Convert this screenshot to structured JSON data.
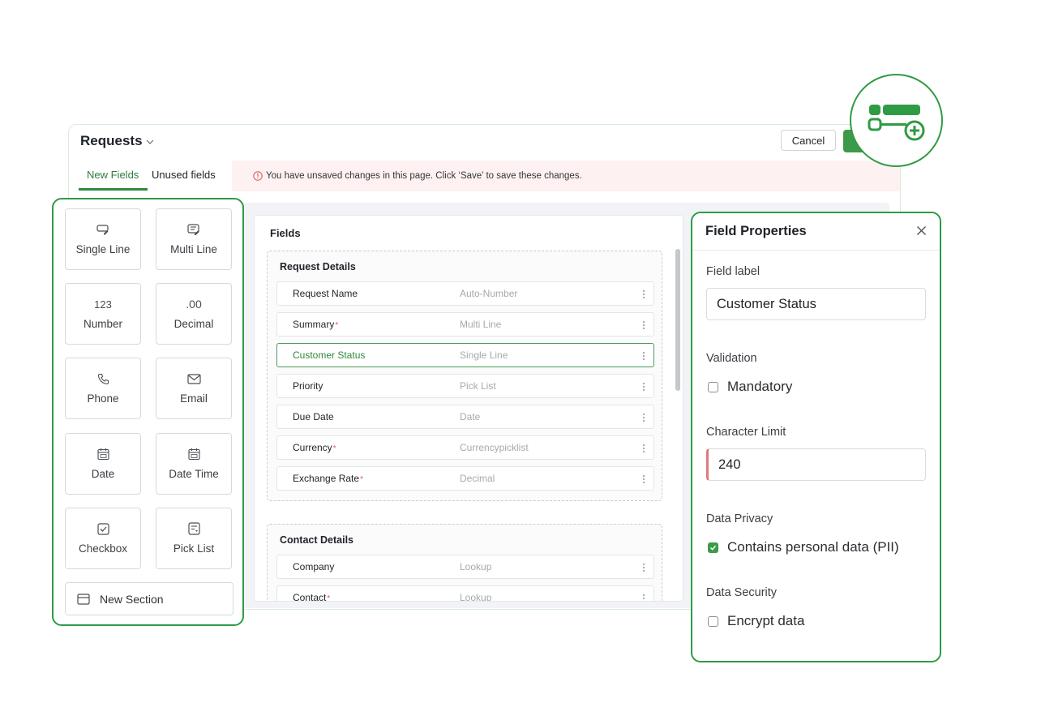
{
  "header": {
    "title": "Requests",
    "cancel_label": "Cancel"
  },
  "tabs": [
    {
      "label": "New Fields",
      "active": true
    },
    {
      "label": "Unused fields",
      "active": false
    }
  ],
  "banner": {
    "text": "You have unsaved changes in this page. Click ‘Save’ to save these changes."
  },
  "palette": {
    "items": [
      {
        "label": "Single Line",
        "icon": "single-line-icon"
      },
      {
        "label": "Multi Line",
        "icon": "multi-line-icon"
      },
      {
        "label": "Number",
        "icon": "number-icon",
        "glyph": "123"
      },
      {
        "label": "Decimal",
        "icon": "decimal-icon",
        "glyph": ".00"
      },
      {
        "label": "Phone",
        "icon": "phone-icon"
      },
      {
        "label": "Email",
        "icon": "email-icon"
      },
      {
        "label": "Date",
        "icon": "calendar-icon"
      },
      {
        "label": "Date Time",
        "icon": "calendar-icon"
      },
      {
        "label": "Checkbox",
        "icon": "checkbox-icon"
      },
      {
        "label": "Pick List",
        "icon": "pick-list-icon"
      }
    ],
    "new_section_label": "New Section"
  },
  "fields_panel": {
    "title": "Fields",
    "sections": [
      {
        "title": "Request Details",
        "rows": [
          {
            "name": "Request Name",
            "type": "Auto-Number",
            "required": false
          },
          {
            "name": "Summary",
            "type": "Multi Line",
            "required": true
          },
          {
            "name": "Customer Status",
            "type": "Single Line",
            "required": false,
            "selected": true
          },
          {
            "name": "Priority",
            "type": "Pick List",
            "required": false
          },
          {
            "name": "Due Date",
            "type": "Date",
            "required": false
          },
          {
            "name": "Currency",
            "type": "Currencypicklist",
            "required": true
          },
          {
            "name": "Exchange Rate",
            "type": "Decimal",
            "required": true
          }
        ]
      },
      {
        "title": "Contact Details",
        "rows": [
          {
            "name": "Company",
            "type": "Lookup",
            "required": false
          },
          {
            "name": "Contact",
            "type": "Lookup",
            "required": true
          }
        ]
      }
    ],
    "required_mark": "*"
  },
  "properties": {
    "title": "Field Properties",
    "field_label_heading": "Field label",
    "field_label_value": "Customer Status",
    "validation_heading": "Validation",
    "mandatory_label": "Mandatory",
    "mandatory_checked": false,
    "char_limit_heading": "Character Limit",
    "char_limit_value": "240",
    "privacy_heading": "Data Privacy",
    "pii_label": "Contains personal data (PII)",
    "pii_checked": true,
    "security_heading": "Data Security",
    "encrypt_label": "Encrypt data",
    "encrypt_checked": false
  },
  "colors": {
    "accent": "#2f9b44",
    "save_button": "#3c9a48",
    "banner_bg": "#fdf1f1",
    "required_mark": "#e25b5b"
  }
}
